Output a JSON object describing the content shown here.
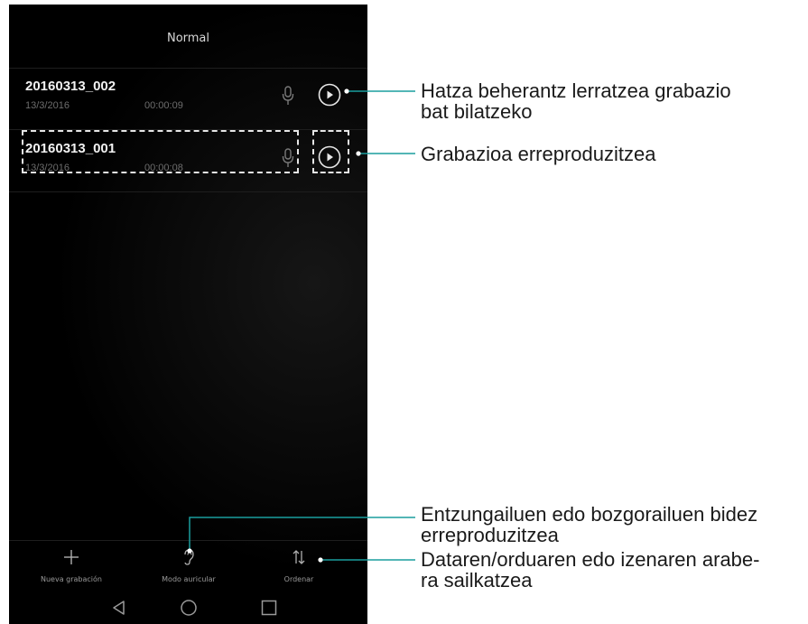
{
  "header": {
    "title": "Normal"
  },
  "recordings": [
    {
      "name": "20160313_002",
      "date": "13/3/2016",
      "duration": "00:00:09"
    },
    {
      "name": "20160313_001",
      "date": "13/3/2016",
      "duration": "00:00:08"
    }
  ],
  "toolbar": {
    "new_label": "Nueva grabación",
    "earpiece_label": "Modo auricular",
    "sort_label": "Ordenar"
  },
  "callouts": {
    "search_line1": "Hatza beherantz lerratzea grabazio",
    "search_line2": "bat bilatzeko",
    "play": "Grabazioa erreproduzitzea",
    "earpiece_line1": "Entzungailuen edo bozgorailuen bidez",
    "earpiece_line2": "erreproduzitzea",
    "sort_line1": "Dataren/orduaren edo izenaren arabe-",
    "sort_line2": "ra sailkatzea"
  }
}
